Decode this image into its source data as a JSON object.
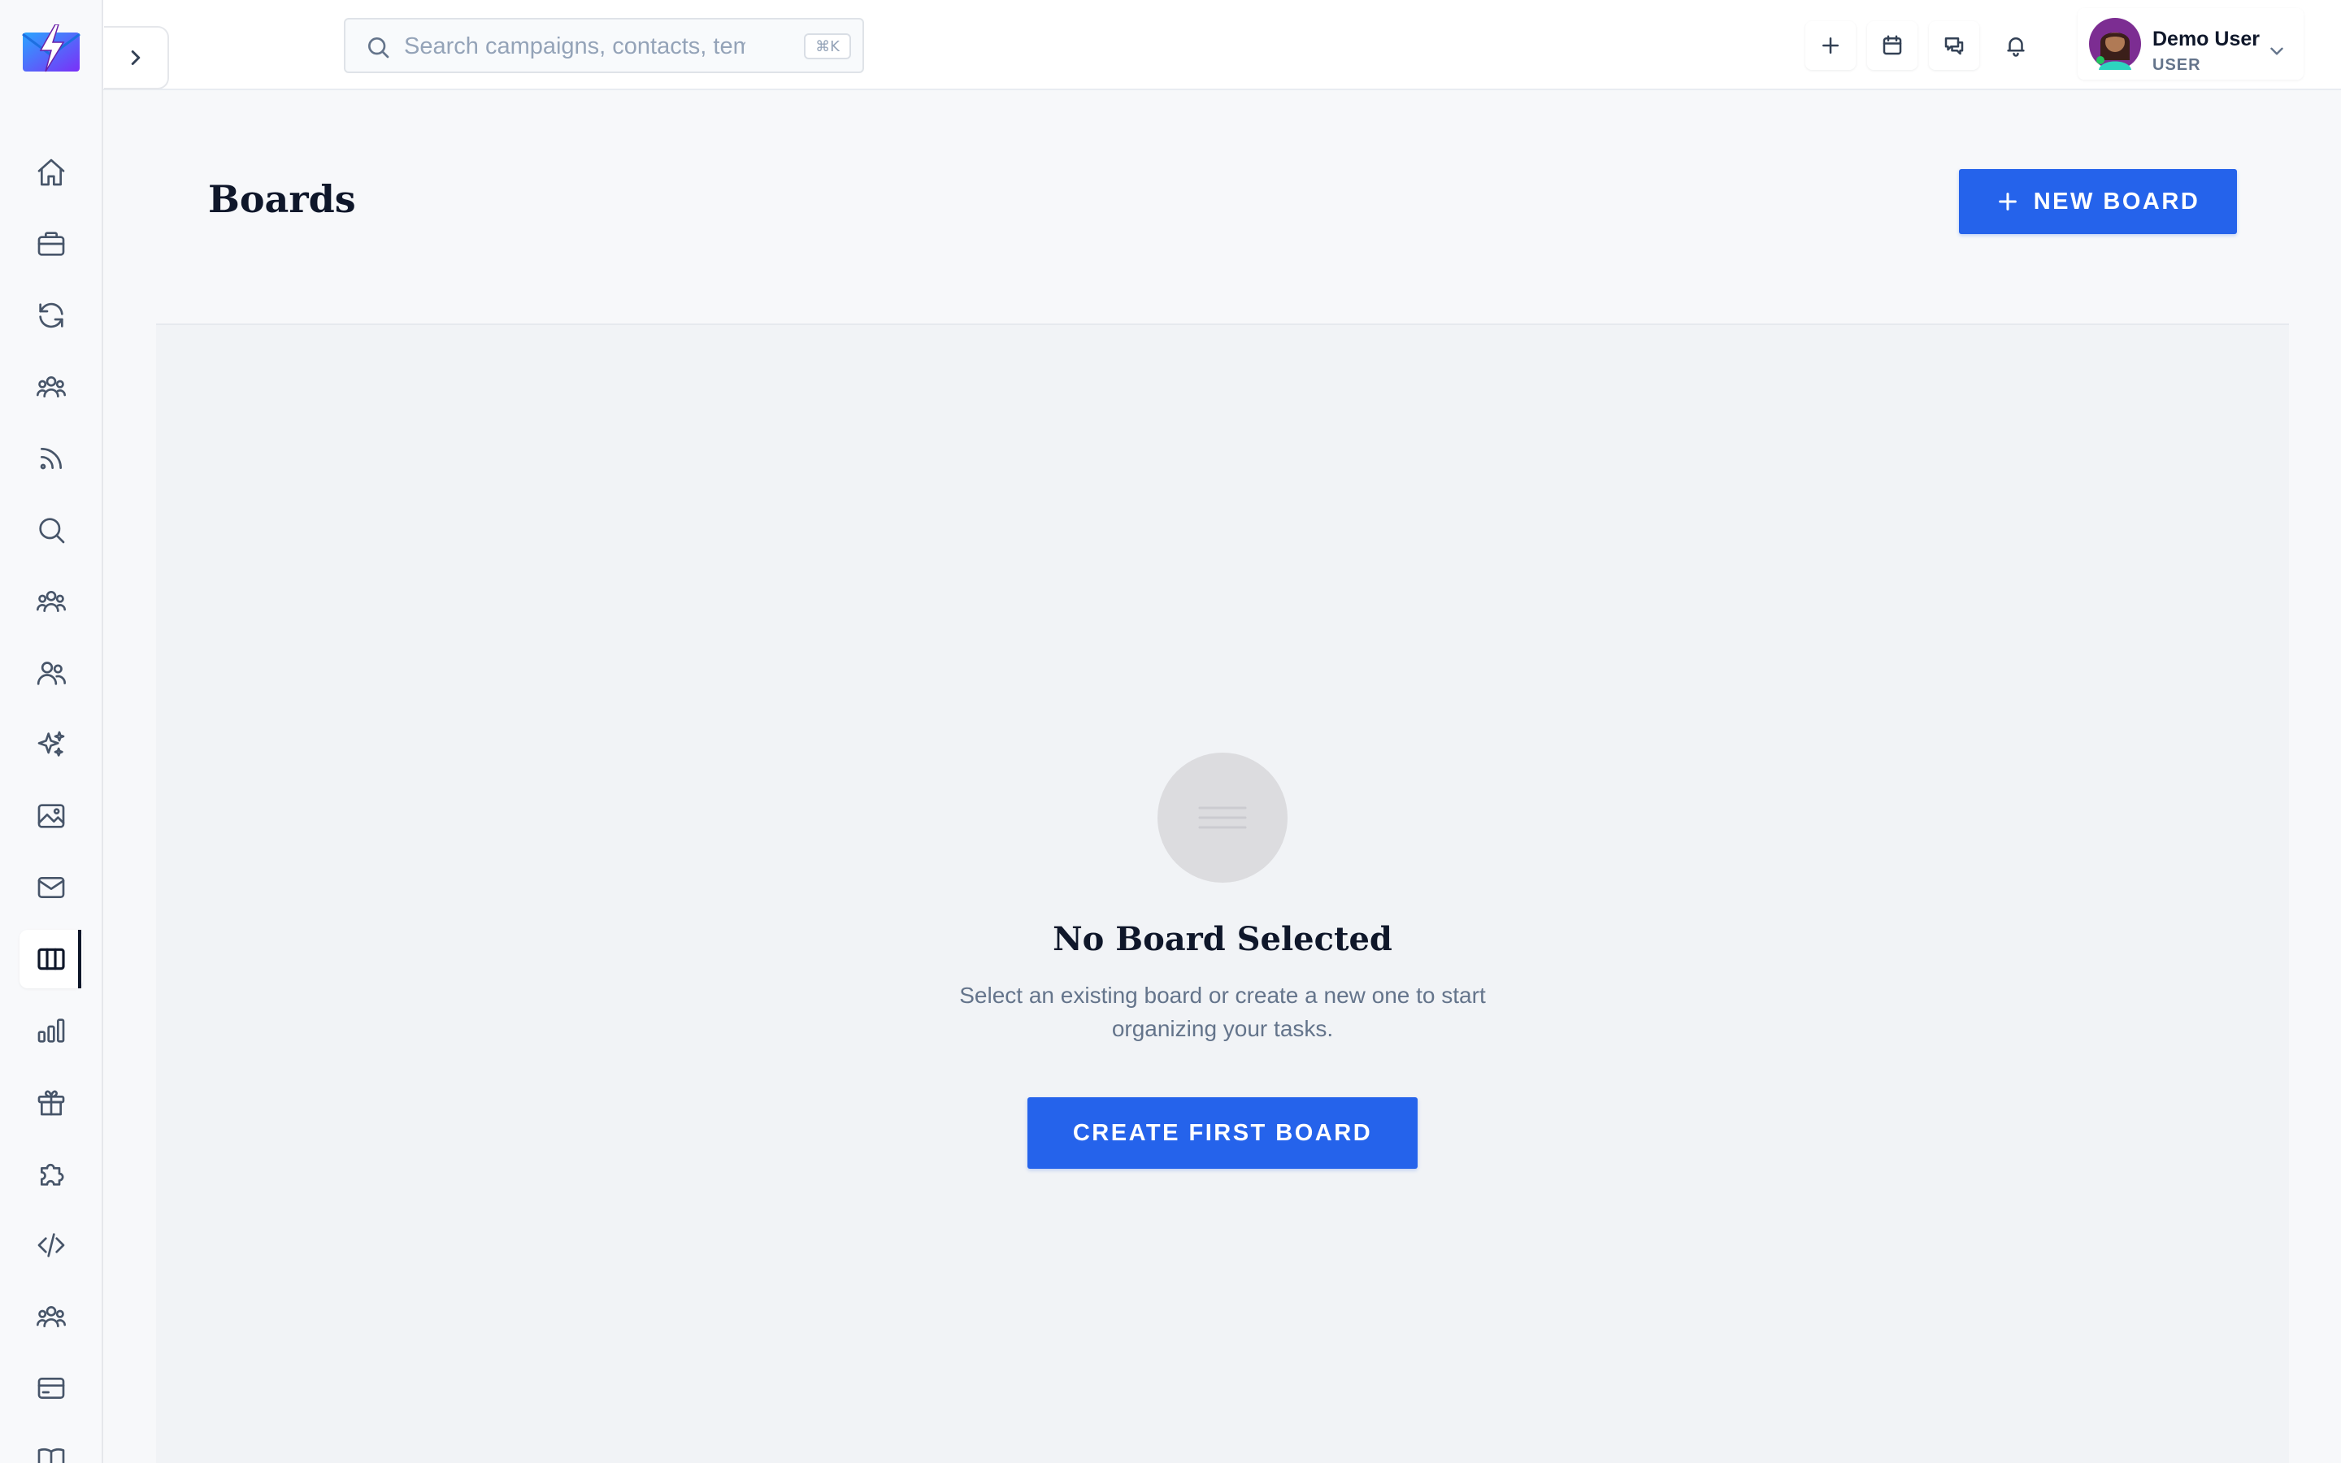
{
  "app": {
    "accent_color": "#2563eb",
    "logo_icon": "lightning-envelope-logo"
  },
  "sidebar": {
    "expand_icon": "chevron-right-icon",
    "items": [
      {
        "icon": "home-icon"
      },
      {
        "icon": "briefcase-icon"
      },
      {
        "icon": "refresh-icon"
      },
      {
        "icon": "users-group-icon"
      },
      {
        "icon": "rss-icon"
      },
      {
        "icon": "search-icon"
      },
      {
        "icon": "users-group-icon"
      },
      {
        "icon": "users-icon"
      },
      {
        "icon": "sparkles-icon"
      },
      {
        "icon": "image-icon"
      },
      {
        "icon": "mail-icon"
      },
      {
        "icon": "kanban-columns-icon",
        "active": true
      },
      {
        "icon": "bar-chart-icon"
      },
      {
        "icon": "gift-icon"
      },
      {
        "icon": "puzzle-icon"
      },
      {
        "icon": "code-icon"
      },
      {
        "icon": "users-group-icon"
      },
      {
        "icon": "credit-card-icon"
      },
      {
        "icon": "book-icon"
      }
    ]
  },
  "header": {
    "search": {
      "placeholder": "Search campaigns, contacts, templa",
      "shortcut": "⌘K"
    },
    "actions": [
      {
        "icon": "plus-icon"
      },
      {
        "icon": "calendar-icon"
      },
      {
        "icon": "chat-icon"
      },
      {
        "icon": "bell-icon"
      }
    ],
    "user": {
      "name": "Demo User",
      "role": "USER"
    }
  },
  "page": {
    "title": "Boards",
    "new_board_label": "NEW BOARD"
  },
  "empty_state": {
    "icon": "menu-lines-icon",
    "title": "No Board Selected",
    "description": "Select an existing board or create a new one to start organizing your tasks.",
    "button_label": "CREATE FIRST BOARD"
  }
}
